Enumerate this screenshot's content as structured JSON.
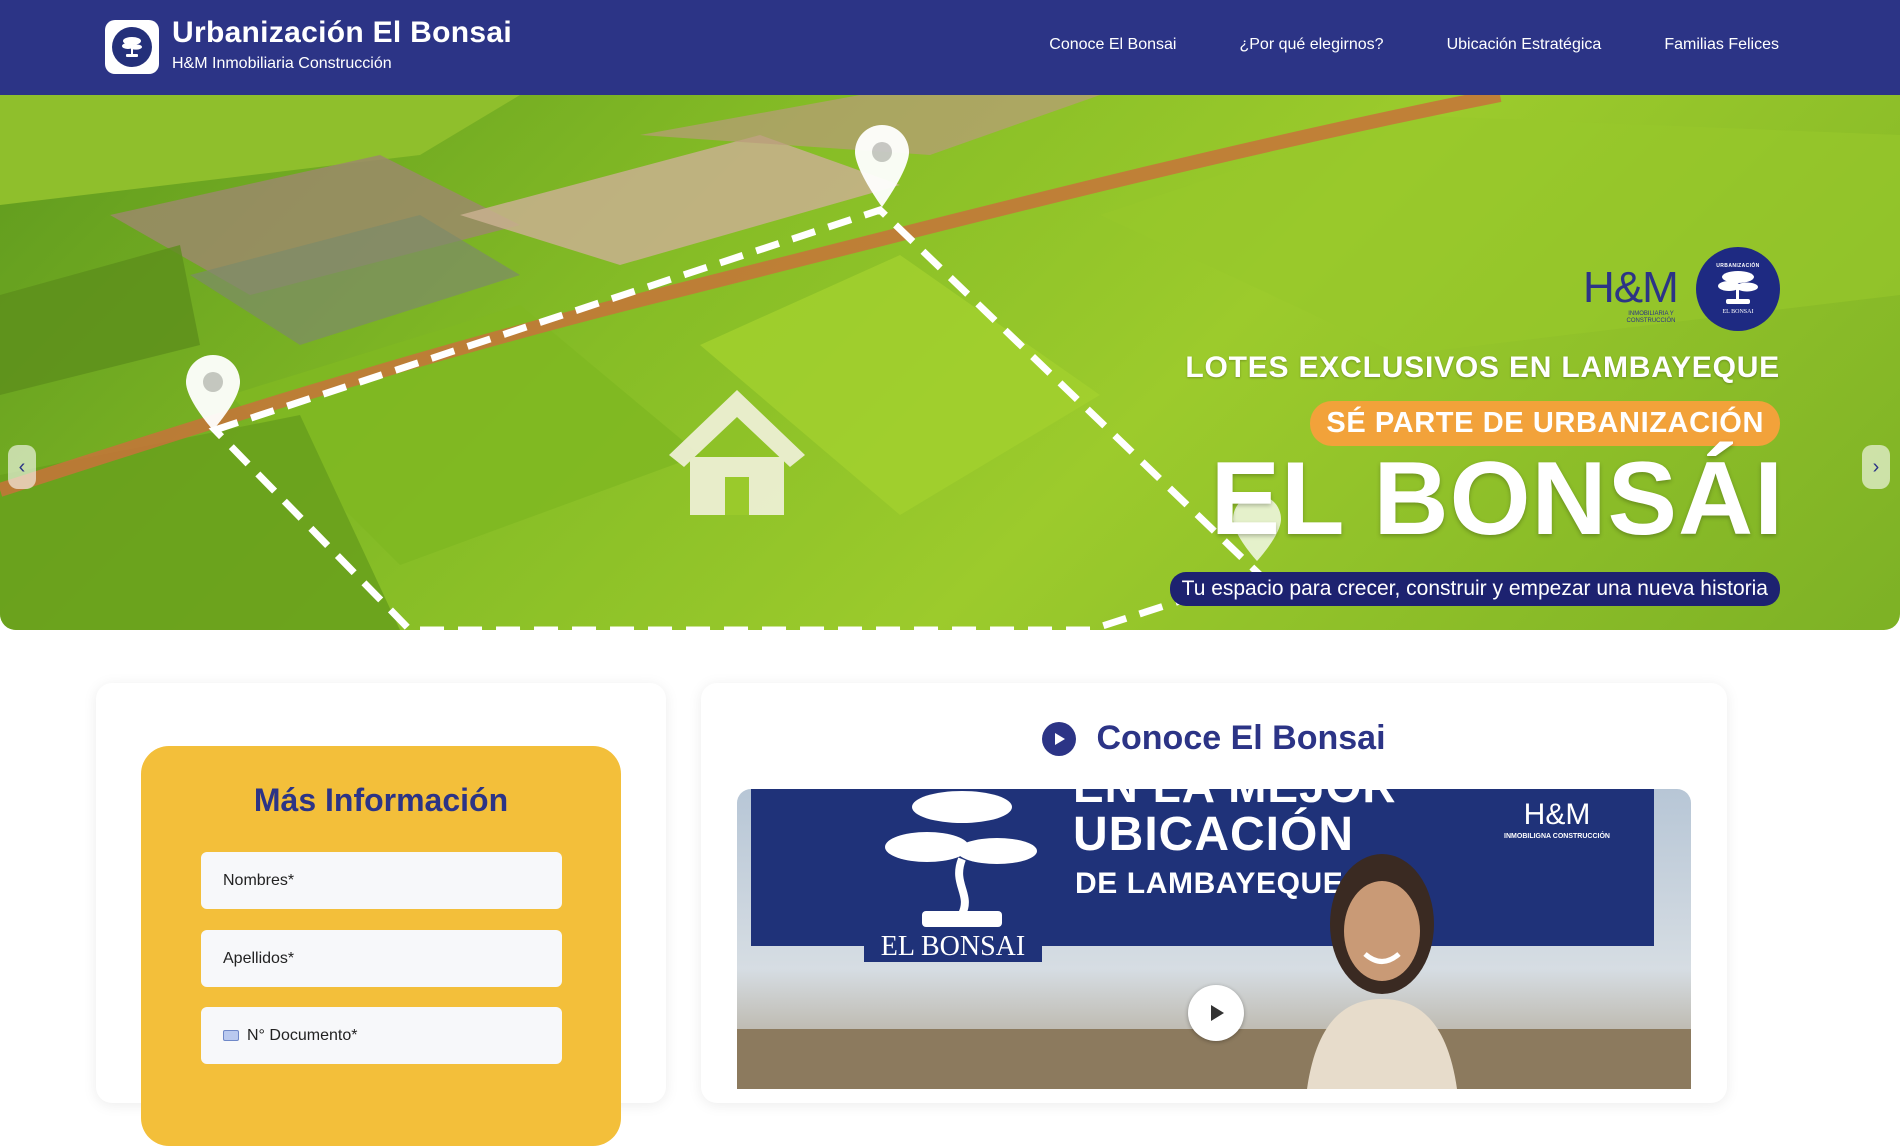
{
  "header": {
    "title": "Urbanización El Bonsai",
    "subtitle": "H&M Inmobiliaria Construcción",
    "nav": [
      {
        "label": "Conoce El Bonsai"
      },
      {
        "label": "¿Por qué elegirnos?"
      },
      {
        "label": "Ubicación Estratégica"
      },
      {
        "label": "Familias Felices"
      }
    ]
  },
  "hero": {
    "brand_mark": "H&M",
    "brand_small": "INMOBILIARIA Y CONSTRUCCIÓN",
    "seal_top": "URBANIZACIÓN",
    "seal_bottom": "EL BONSAI",
    "line1": "LOTES EXCLUSIVOS EN LAMBAYEQUE",
    "pill": "SÉ PARTE DE URBANIZACIÓN",
    "big": "EL BONSÁI",
    "tagline": "Tu espacio para crecer, construir y empezar una nueva historia",
    "prev_icon": "‹",
    "next_icon": "›"
  },
  "form": {
    "title": "Más Información",
    "fields": [
      {
        "placeholder": "Nombres*"
      },
      {
        "placeholder": "Apellidos*"
      },
      {
        "placeholder": "N° Documento*"
      }
    ]
  },
  "video_section": {
    "heading": "Conoce El Bonsai",
    "video": {
      "line1": "EN LA MEJOR",
      "line2": "UBICACIÓN",
      "line3": "DE LAMBAYEQUE",
      "brand": "EL BONSAI",
      "hm": "H&M",
      "hm_small": "INMOBILIGNA CONSTRUCCIÓN"
    }
  },
  "colors": {
    "primary": "#2c3486",
    "accent_yellow": "#f3bf3a",
    "accent_orange": "#f2a23a",
    "dark_navy": "#1d2270"
  }
}
